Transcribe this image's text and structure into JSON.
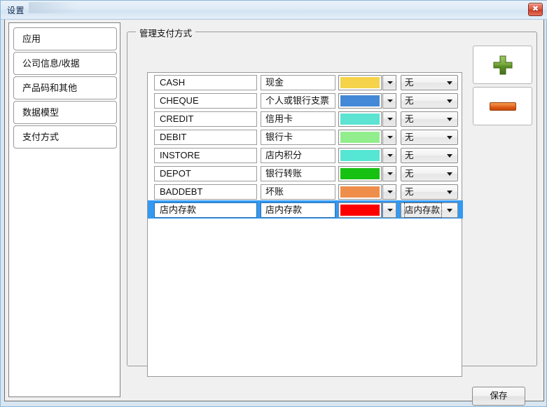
{
  "window": {
    "title": "设置",
    "close_icon": "✖"
  },
  "sidebar": {
    "items": [
      {
        "label": "应用"
      },
      {
        "label": "公司信息/收据"
      },
      {
        "label": "产品码和其他"
      },
      {
        "label": "数据模型"
      },
      {
        "label": "支付方式"
      }
    ]
  },
  "groupbox": {
    "title": "管理支付方式"
  },
  "payment_rows": [
    {
      "code": "CASH",
      "name": "现金",
      "color": "#f5d34a",
      "mapping": "无",
      "selected": false
    },
    {
      "code": "CHEQUE",
      "name": "个人或银行支票",
      "color": "#4488d8",
      "mapping": "无",
      "selected": false
    },
    {
      "code": "CREDIT",
      "name": "信用卡",
      "color": "#5ce3d2",
      "mapping": "无",
      "selected": false
    },
    {
      "code": "DEBIT",
      "name": "银行卡",
      "color": "#92ee8d",
      "mapping": "无",
      "selected": false
    },
    {
      "code": "INSTORE",
      "name": "店内积分",
      "color": "#55e6d4",
      "mapping": "无",
      "selected": false
    },
    {
      "code": "DEPOT",
      "name": "银行转账",
      "color": "#16c112",
      "mapping": "无",
      "selected": false
    },
    {
      "code": "BADDEBT",
      "name": "坏账",
      "color": "#ef8e4b",
      "mapping": "无",
      "selected": false
    },
    {
      "code": "店内存款",
      "name": "店内存款",
      "color": "#ff0000",
      "mapping": "店内存款",
      "selected": true
    }
  ],
  "actions": {
    "add_icon": "plus-icon",
    "remove_icon": "minus-icon"
  },
  "footer": {
    "save_label": "保存"
  },
  "theme": {
    "selection_blue": "#3399f2",
    "close_red": "#cf3a24",
    "plus_green": "#4f8a1e"
  }
}
